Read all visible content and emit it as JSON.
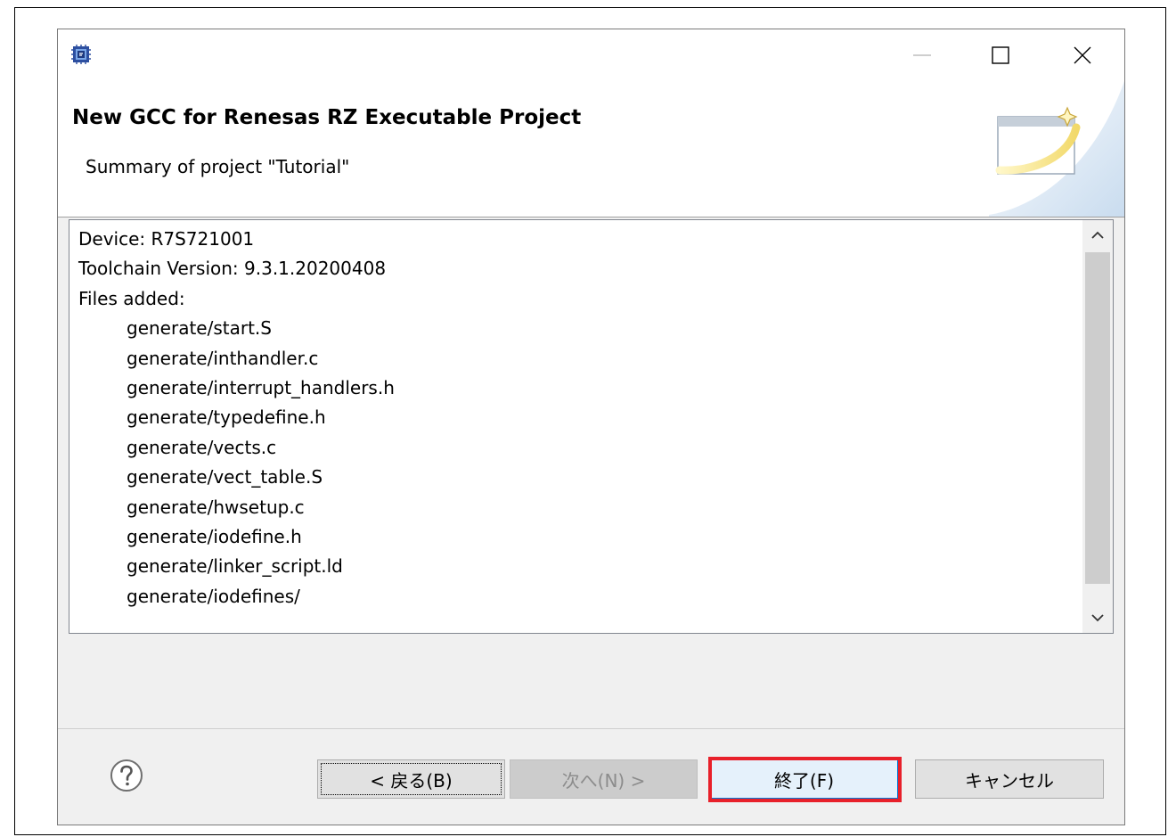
{
  "header": {
    "title": "New GCC for Renesas RZ Executable Project",
    "subtitle": "Summary of project \"Tutorial\""
  },
  "summary": {
    "lines": [
      "Device: R7S721001",
      "Toolchain Version: 9.3.1.20200408",
      "Files added:"
    ],
    "files": [
      "generate/start.S",
      "generate/inthandler.c",
      "generate/interrupt_handlers.h",
      "generate/typedefine.h",
      "generate/vects.c",
      "generate/vect_table.S",
      "generate/hwsetup.c",
      "generate/iodefine.h",
      "generate/linker_script.ld",
      "generate/iodefines/"
    ]
  },
  "buttons": {
    "back": "< 戻る(B)",
    "next": "次へ(N) >",
    "finish": "終了(F)",
    "cancel": "キャンセル"
  },
  "icons": {
    "app": "renesas-chip-icon",
    "help": "help-question-icon",
    "banner": "wizard-banner-icon"
  },
  "colors": {
    "highlight": "#e8202a",
    "default_button_border": "#0078d7"
  }
}
